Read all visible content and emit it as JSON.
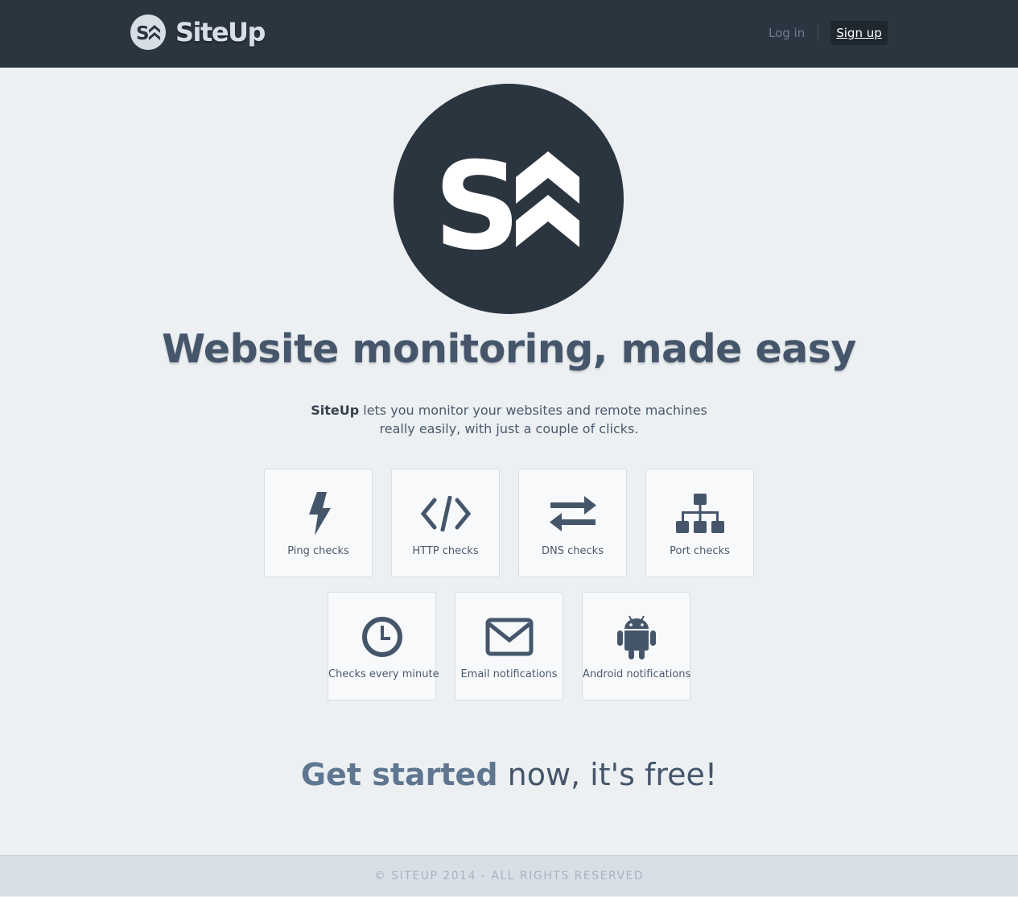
{
  "header": {
    "brand_name": "SiteUp",
    "brand_logo_letter": "S",
    "login_label": "Log in",
    "signup_label": "Sign up"
  },
  "hero": {
    "logo_letter": "S",
    "headline": "Website monitoring, made easy",
    "intro_strong": "SiteUp",
    "intro_line1": " lets you monitor your websites and remote machines",
    "intro_line2": "really easily, with just a couple of clicks."
  },
  "features": [
    {
      "label": "Ping checks",
      "icon": "bolt-icon"
    },
    {
      "label": "HTTP checks",
      "icon": "code-icon"
    },
    {
      "label": "DNS checks",
      "icon": "exchange-arrows-icon"
    },
    {
      "label": "Port checks",
      "icon": "sitemap-icon"
    },
    {
      "label": "Checks every minute",
      "icon": "clock-icon"
    },
    {
      "label": "Email notifications",
      "icon": "envelope-icon"
    },
    {
      "label": "Android notifications",
      "icon": "android-icon"
    }
  ],
  "cta": {
    "link_text": "Get started",
    "rest_text": " now, it's free!"
  },
  "footer": {
    "copyright": "© SITEUP 2014 - ALL RIGHTS RESERVED"
  },
  "colors": {
    "topbar": "#2b3540",
    "background": "#ecf0f3",
    "text": "#45566b",
    "accent": "#5f7690",
    "footer": "#d8dfe6"
  }
}
